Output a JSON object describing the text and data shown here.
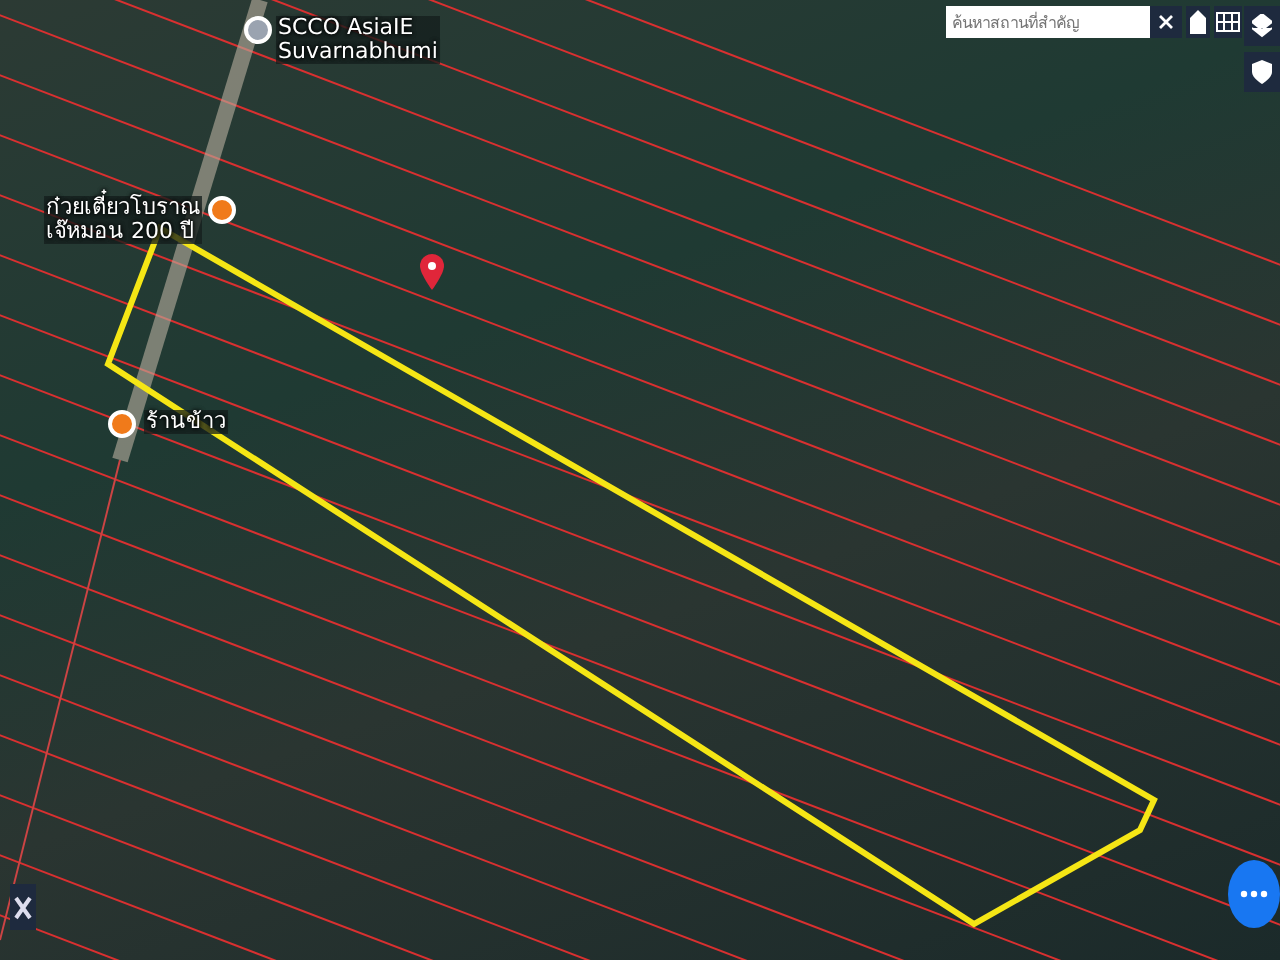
{
  "search": {
    "placeholder": "ค้นหาสถานที่สำคัญ"
  },
  "places": [
    {
      "name": "SCCO AsiaIE\nSuvarnabhumi",
      "kind": "landmark"
    },
    {
      "name": "ก๋วยเตี๋ยวโบราณ\nเจ๊หมอน 200 ปี",
      "kind": "restaurant"
    },
    {
      "name": "ร้านข้าว",
      "kind": "restaurant"
    },
    {
      "kind": "pin"
    }
  ]
}
